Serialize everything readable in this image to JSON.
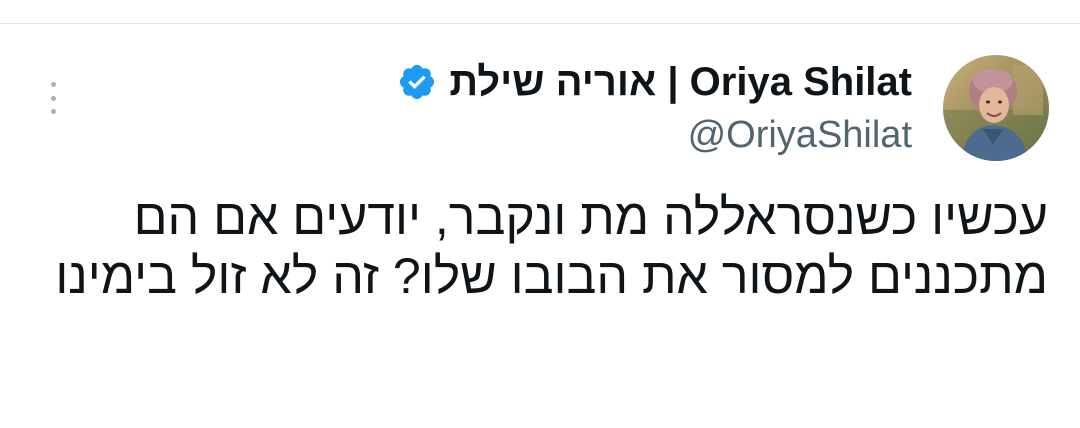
{
  "tweet": {
    "author": {
      "display_name": "אוריה שילת | Oriya Shilat",
      "handle": "@OriyaShilat",
      "verified": true,
      "verified_color": "#1d9bf0"
    },
    "text": "עכשיו כשנסראללה מת ונקבר, יודעים אם הם מתכננים למסור את הבובו שלו? זה לא זול בימינו",
    "icons": {
      "verified": "verified-badge-icon",
      "more": "more-vertical-icon"
    }
  },
  "colors": {
    "text_primary": "#0f1419",
    "text_secondary": "#536471",
    "divider": "#e3e6e9",
    "background": "#ffffff"
  }
}
